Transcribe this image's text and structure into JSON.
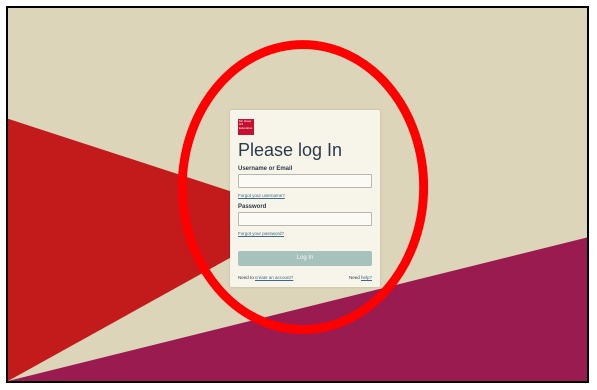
{
  "colors": {
    "bg_beige": "#dcd5b9",
    "bg_red": "#c31a1c",
    "bg_maroon": "#991b4f",
    "card_bg": "#f7f4ea",
    "title_text": "#2c3b4a",
    "button_bg": "#a7c2bd",
    "annotation_ring": "#ff0000"
  },
  "logo": {
    "text": "Mc Graw Hill Education"
  },
  "login": {
    "title": "Please log In",
    "username_label": "Username or Email",
    "username_value": "",
    "forgot_username": "Forgot your username?",
    "password_label": "Password",
    "password_value": "",
    "forgot_password": "Forgot your password?",
    "login_button": "Log In",
    "need_to_text": "Need to",
    "create_account_link": "create an account?",
    "need_text": "Need",
    "help_link": "help?"
  }
}
